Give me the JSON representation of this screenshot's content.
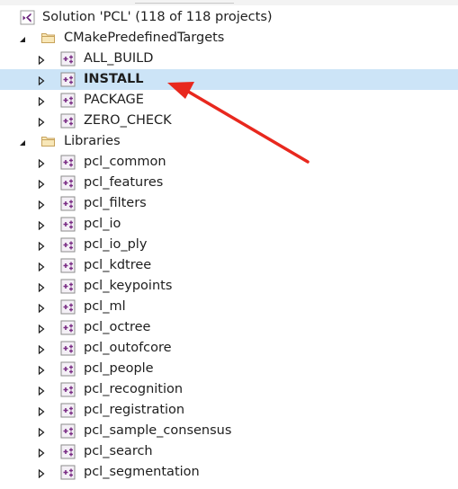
{
  "solution": {
    "label": "Solution 'PCL' (118 of 118 projects)",
    "icon": "visual-studio-solution-icon"
  },
  "folders": [
    {
      "label": "CMakePredefinedTargets",
      "expanded": true,
      "icon": "folder-icon",
      "projects": [
        {
          "label": "ALL_BUILD",
          "selected": false
        },
        {
          "label": "INSTALL",
          "selected": true
        },
        {
          "label": "PACKAGE",
          "selected": false
        },
        {
          "label": "ZERO_CHECK",
          "selected": false
        }
      ]
    },
    {
      "label": "Libraries",
      "expanded": true,
      "icon": "folder-icon",
      "projects": [
        {
          "label": "pcl_common"
        },
        {
          "label": "pcl_features"
        },
        {
          "label": "pcl_filters"
        },
        {
          "label": "pcl_io"
        },
        {
          "label": "pcl_io_ply"
        },
        {
          "label": "pcl_kdtree"
        },
        {
          "label": "pcl_keypoints"
        },
        {
          "label": "pcl_ml"
        },
        {
          "label": "pcl_octree"
        },
        {
          "label": "pcl_outofcore"
        },
        {
          "label": "pcl_people"
        },
        {
          "label": "pcl_recognition"
        },
        {
          "label": "pcl_registration"
        },
        {
          "label": "pcl_sample_consensus"
        },
        {
          "label": "pcl_search"
        },
        {
          "label": "pcl_segmentation"
        }
      ]
    }
  ],
  "annotation": {
    "type": "arrow",
    "color": "#e8281e",
    "points_to": "INSTALL"
  },
  "colors": {
    "selection": "#cce4f7",
    "folder": "#dcb67a",
    "project_icon": "#7a2d85",
    "expander": "#1e1e1e"
  }
}
